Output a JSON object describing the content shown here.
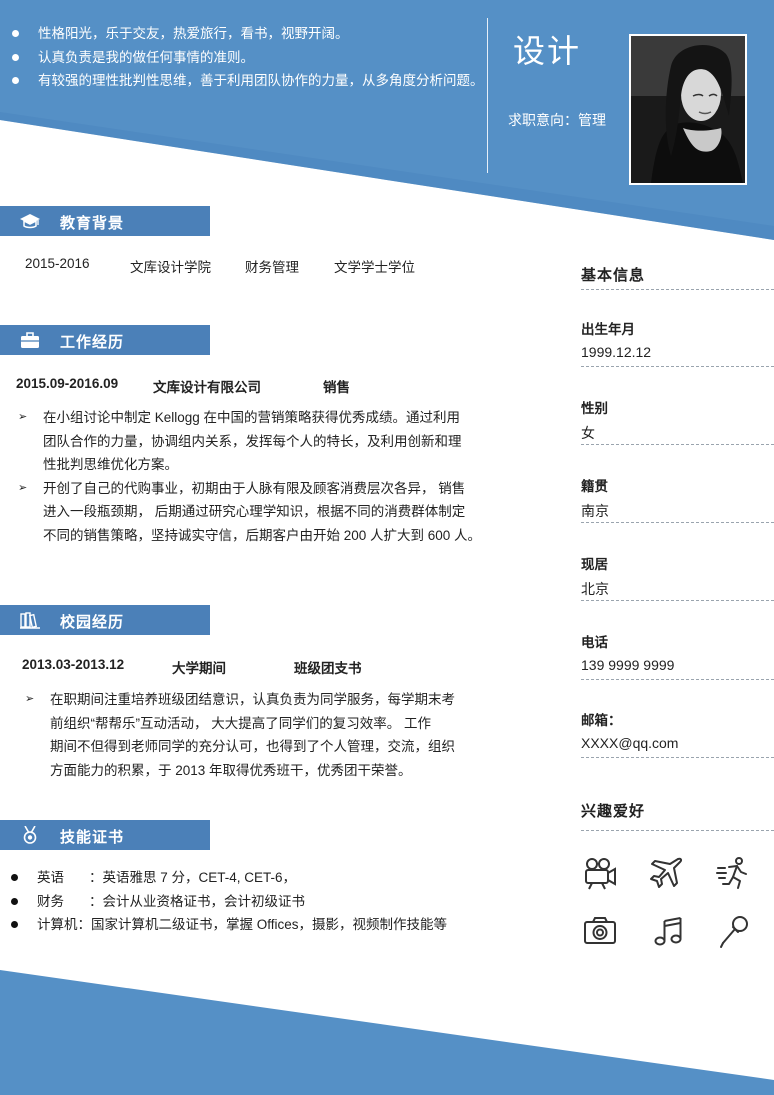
{
  "intro_bullets": [
    "性格阳光，乐于交友，热爱旅行，看书，视野开阔。",
    "认真负责是我的做任何事情的准则。",
    "有较强的理性批判性思维，善于利用团队协作的力量，从多角度分析问题。"
  ],
  "header": {
    "name": "设计",
    "intent_label": "求职意向：",
    "intent_value": "管理"
  },
  "education": {
    "title": "教育背景",
    "period": "2015-2016",
    "school": "文库设计学院",
    "major": "财务管理",
    "degree": "文学学士学位"
  },
  "work": {
    "title": "工作经历",
    "period": "2015.09-2016.09",
    "company": "文库设计有限公司",
    "position": "销售",
    "bullets": [
      [
        "在小组讨论中制定 Kellogg 在中国的营销策略获得优秀成绩。通过利用",
        "团队合作的力量，协调组内关系，发挥每个人的特长，及利用创新和理",
        "性批判思维优化方案。"
      ],
      [
        "开创了自己的代购事业，初期由于人脉有限及顾客消费层次各异，  销售",
        "进入一段瓶颈期，  后期通过研究心理学知识，根据不同的消费群体制定",
        "不同的销售策略，坚持诚实守信，后期客户由开始 200 人扩大到 600 人。"
      ]
    ]
  },
  "campus": {
    "title": "校园经历",
    "period": "2013.03-2013.12",
    "org": "大学期间",
    "role": "班级团支书",
    "bullets": [
      [
        "在职期间注重培养班级团结意识，认真负责为同学服务，每学期末考",
        "前组织“帮帮乐”互动活动，  大大提高了同学们的复习效率。  工作",
        "期间不但得到老师同学的充分认可，也得到了个人管理，交流，组织",
        "方面能力的积累，于 2013 年取得优秀班干，优秀团干荣誉。"
      ]
    ]
  },
  "skills": {
    "title": "技能证书",
    "items": [
      {
        "label": "英语",
        "sep": "：",
        "value": "英语雅思 7 分，CET-4, CET-6，"
      },
      {
        "label": "财务",
        "sep": "：",
        "value": "会计从业资格证书，会计初级证书"
      },
      {
        "label": "计算机",
        "sep": "：",
        "value": "国家计算机二级证书，掌握 Offices，摄影，视频制作技能等"
      }
    ]
  },
  "basic_info": {
    "title": "基本信息",
    "fields": [
      {
        "label": "出生年月",
        "value": "1999.12.12"
      },
      {
        "label": "性别",
        "value": "女"
      },
      {
        "label": "籍贯",
        "value": "南京"
      },
      {
        "label": "现居",
        "value": "北京"
      },
      {
        "label": "电话",
        "value": "139 9999 9999"
      },
      {
        "label": "邮箱：",
        "value": "XXXX@qq.com"
      }
    ]
  },
  "hobbies": {
    "title": "兴趣爱好",
    "icons": [
      "video-camera-icon",
      "airplane-icon",
      "running-icon",
      "camera-icon",
      "music-note-icon",
      "microphone-icon"
    ]
  },
  "colors": {
    "accent": "#4b80b8",
    "header_blue": "#5590c6"
  }
}
